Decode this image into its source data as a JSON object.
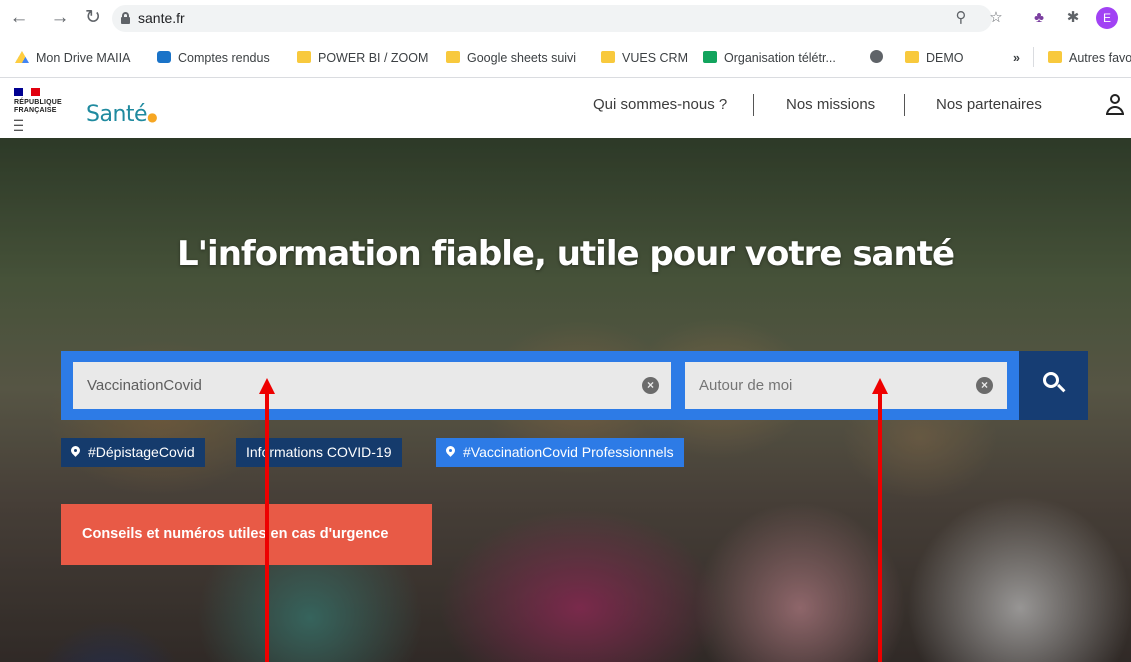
{
  "browser": {
    "url": "sante.fr",
    "profile_initial": "E",
    "bookmarks": [
      {
        "label": "Mon Drive MAIIA",
        "icon": "google-drive-icon"
      },
      {
        "label": "Comptes rendus",
        "icon": "sharepoint-icon"
      },
      {
        "label": "POWER BI / ZOOM",
        "icon": "folder-icon"
      },
      {
        "label": "Google sheets suivi",
        "icon": "folder-icon"
      },
      {
        "label": "VUES CRM",
        "icon": "folder-icon"
      },
      {
        "label": "Organisation télétr...",
        "icon": "trello-icon"
      },
      {
        "label": "",
        "icon": "globe-icon"
      },
      {
        "label": "DEMO",
        "icon": "folder-icon"
      },
      {
        "label": "»",
        "icon": "overflow-icon"
      },
      {
        "label": "Autres favo",
        "icon": "folder-icon"
      }
    ]
  },
  "site": {
    "gov_logo_text": "RÉPUBLIQUE FRANÇAISE",
    "logo": "Santé",
    "nav": [
      "Qui sommes-nous ?",
      "Nos missions",
      "Nos partenaires"
    ]
  },
  "hero": {
    "title": "L'information fiable, utile pour votre santé",
    "search": {
      "query_value": "VaccinationCovid",
      "location_placeholder": "Autour de moi"
    },
    "tags": [
      "#DépistageCovid",
      "Informations COVID-19",
      "#VaccinationCovid Professionnels"
    ],
    "urgence_label": "Conseils et numéros utiles en cas d'urgence"
  },
  "colors": {
    "search_blue": "#2d7be6",
    "dark_blue": "#153b6c",
    "urgence_red": "#e85a46",
    "annotation_red": "#ee0000",
    "logo_teal": "#1f8a9f"
  }
}
